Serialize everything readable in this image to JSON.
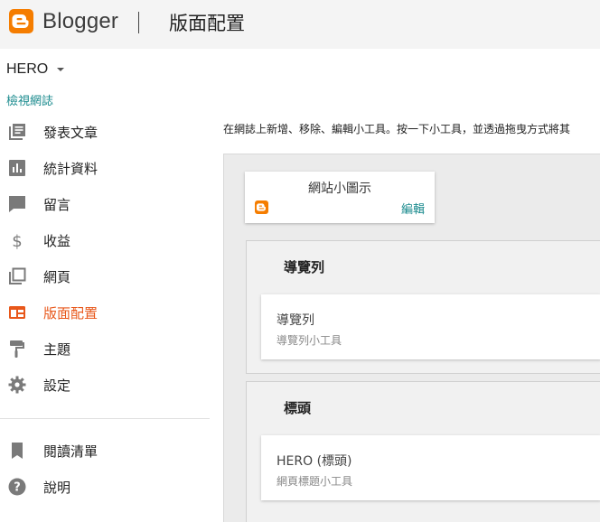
{
  "header": {
    "brand": "Blogger",
    "page_title": "版面配置",
    "logo_color": "#f57d00"
  },
  "sidebar": {
    "blog_name": "HERO",
    "view_blog": "檢視網誌",
    "active_color": "#e8571a",
    "items": [
      {
        "label": "發表文章",
        "icon": "posts-icon"
      },
      {
        "label": "統計資料",
        "icon": "stats-icon"
      },
      {
        "label": "留言",
        "icon": "comments-icon"
      },
      {
        "label": "收益",
        "icon": "earnings-icon"
      },
      {
        "label": "網頁",
        "icon": "pages-icon"
      },
      {
        "label": "版面配置",
        "icon": "layout-icon",
        "active": true
      },
      {
        "label": "主題",
        "icon": "theme-icon"
      },
      {
        "label": "設定",
        "icon": "settings-icon"
      }
    ],
    "secondary": [
      {
        "label": "閱讀清單",
        "icon": "reading-list-icon"
      },
      {
        "label": "說明",
        "icon": "help-icon"
      }
    ]
  },
  "main": {
    "instruction": "在網誌上新增、移除、編輯小工具。按一下小工具，並透過拖曳方式將其",
    "favicon_card": {
      "name": "網站小圖示",
      "edit": "編輯"
    },
    "sections": [
      {
        "title": "導覽列",
        "gadget": {
          "name": "導覽列",
          "desc": "導覽列小工具"
        }
      },
      {
        "title": "標頭",
        "gadget": {
          "name": "HERO (標頭)",
          "desc": "網頁標題小工具"
        }
      }
    ]
  }
}
